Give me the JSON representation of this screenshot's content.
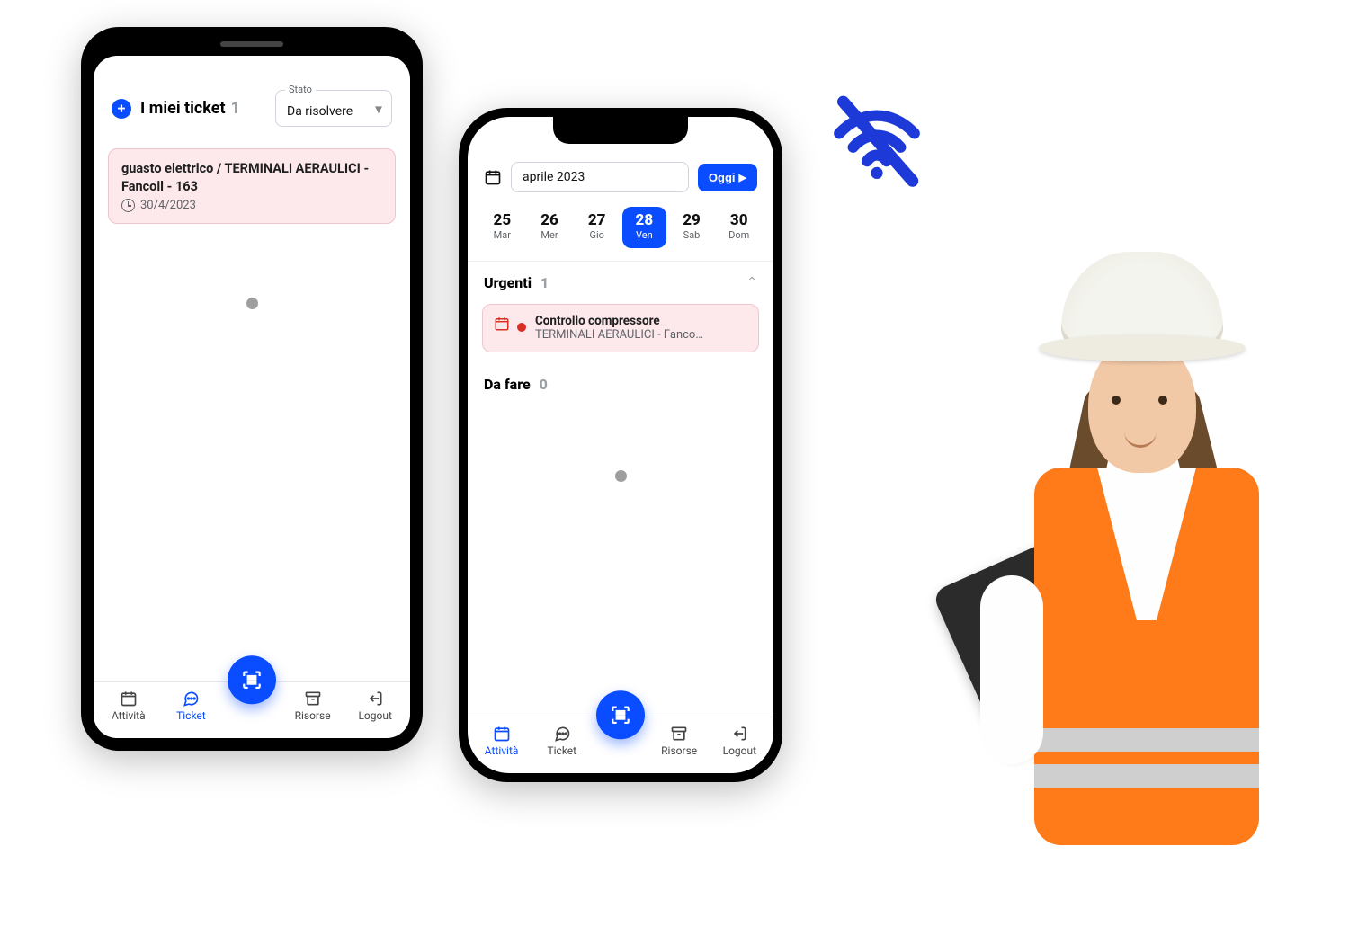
{
  "ticket_screen": {
    "title": "I miei ticket",
    "count": "1",
    "filter": {
      "label": "Stato",
      "value": "Da risolvere"
    },
    "cards": [
      {
        "title": "guasto elettrico / TERMINALI AERAULICI - Fancoil - 163",
        "date": "30/4/2023"
      }
    ]
  },
  "activity_screen": {
    "month": "aprile 2023",
    "today_label": "Oggi",
    "days": [
      {
        "num": "25",
        "dow": "Mar"
      },
      {
        "num": "26",
        "dow": "Mer"
      },
      {
        "num": "27",
        "dow": "Gio"
      },
      {
        "num": "28",
        "dow": "Ven"
      },
      {
        "num": "29",
        "dow": "Sab"
      },
      {
        "num": "30",
        "dow": "Dom"
      }
    ],
    "selected_index": 3,
    "sections": {
      "urgent": {
        "label": "Urgenti",
        "count": "1",
        "items": [
          {
            "title": "Controllo compressore",
            "subtitle": "TERMINALI AERAULICI - Fancoil - ..."
          }
        ]
      },
      "todo": {
        "label": "Da fare",
        "count": "0"
      }
    }
  },
  "nav": {
    "attivita": "Attività",
    "ticket": "Ticket",
    "risorse": "Risorse",
    "logout": "Logout"
  },
  "colors": {
    "primary": "#0a4cff",
    "danger_bg": "#fde9ec",
    "danger": "#d93025"
  }
}
